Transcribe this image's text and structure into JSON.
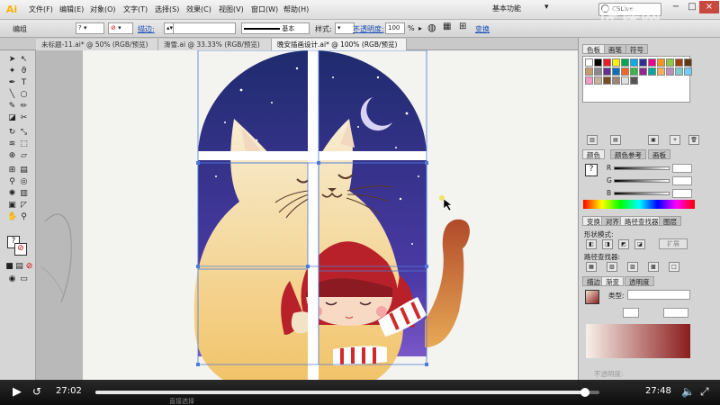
{
  "app": {
    "logo": "Ai"
  },
  "menu": [
    "文件(F)",
    "编辑(E)",
    "对象(O)",
    "文字(T)",
    "选择(S)",
    "效果(C)",
    "视图(V)",
    "窗口(W)",
    "帮助(H)"
  ],
  "workspace": {
    "label": "基本功能",
    "search_placeholder": "CSLive"
  },
  "watermark": "虎课网",
  "window_controls": {
    "minimize": "−",
    "restore": "□",
    "close": "×"
  },
  "controlbar": {
    "mode": "编组",
    "stroke_label": "描边:",
    "basic": "基本",
    "style_label": "样式:",
    "opacity_label": "不透明度:",
    "opacity_value": "100",
    "opacity_unit": "%",
    "transform": "变换"
  },
  "doc_tabs": [
    "未标题-11.ai* @ 50% (RGB/预览)",
    "滑雪.ai @ 33.33% (RGB/预览)",
    "晚安插画设计.ai* @ 100% (RGB/预览)"
  ],
  "panels": {
    "swatches_tabs": [
      "色板",
      "画笔",
      "符号"
    ],
    "color_tabs": [
      "颜色",
      "颜色参考",
      "画板"
    ],
    "color_channels": [
      "R",
      "G",
      "B"
    ],
    "transform_tabs": [
      "变换",
      "对齐",
      "路径查找器",
      "图层"
    ],
    "shape_modes": "形状模式:",
    "expand": "扩展",
    "pathfinder": "路径查找器:",
    "gradient_tabs": [
      "描边",
      "渐变",
      "透明度"
    ],
    "gradient_type": "类型:",
    "gradient_opacity": "不透明度:"
  },
  "player": {
    "current_time": "27:02",
    "total_time": "27:48",
    "progress": 0.972,
    "play_icon": "play-icon",
    "replay_icon": "replay-icon",
    "fullscreen_icon": "fullscreen-icon"
  },
  "status": {
    "hint": "直接选择"
  },
  "colors": {
    "night_top": "#1f2b6e",
    "night_bottom": "#5a3fae",
    "cat": "#f4e6c2",
    "hair": "#b8202a",
    "accent": "#1a4fb8"
  }
}
